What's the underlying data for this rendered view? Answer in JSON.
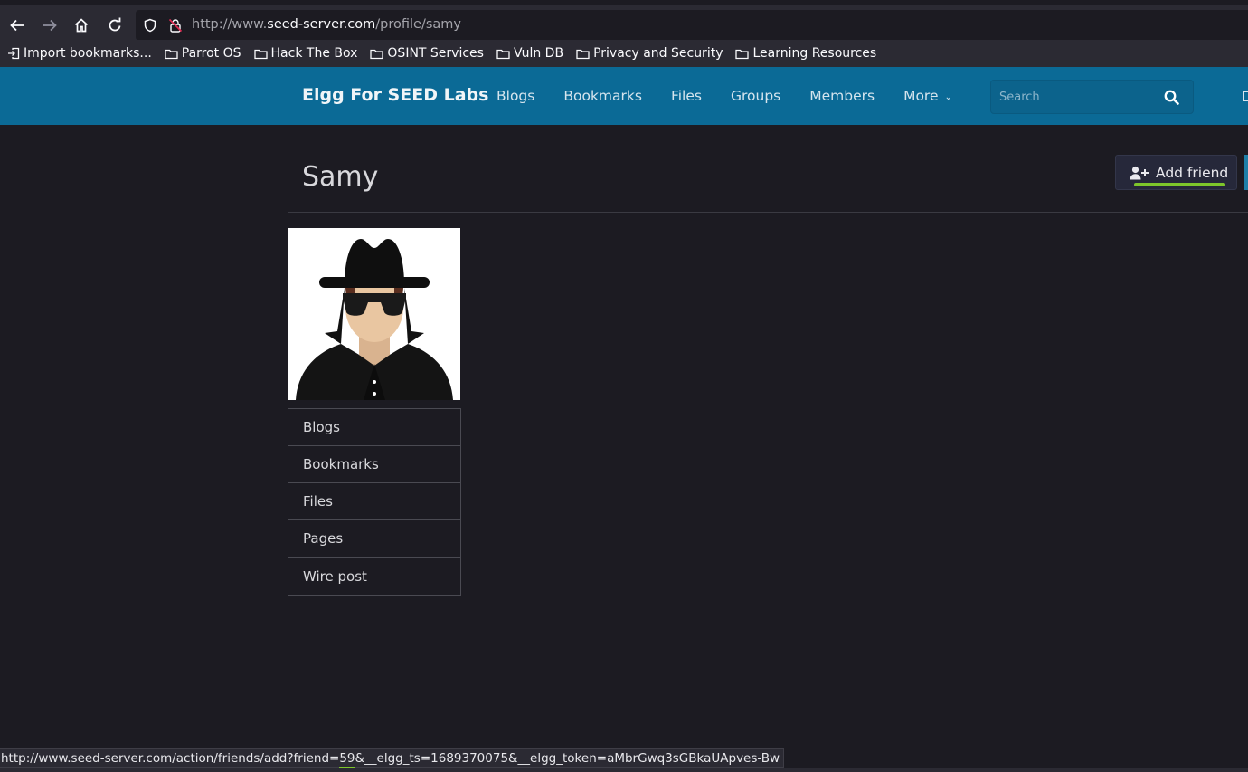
{
  "browser": {
    "url_prefix": "http://www.",
    "url_host": "seed-server.com",
    "url_path": "/profile/samy",
    "bookmarks": [
      {
        "icon": "import-icon",
        "label": "Import bookmarks..."
      },
      {
        "icon": "folder-icon",
        "label": "Parrot OS"
      },
      {
        "icon": "folder-icon",
        "label": "Hack The Box"
      },
      {
        "icon": "folder-icon",
        "label": "OSINT Services"
      },
      {
        "icon": "folder-icon",
        "label": "Vuln DB"
      },
      {
        "icon": "folder-icon",
        "label": "Privacy and Security"
      },
      {
        "icon": "folder-icon",
        "label": "Learning Resources"
      }
    ],
    "status_prefix": "http://www.seed-server.com/action/friends/add?friend=",
    "status_highlight": "59",
    "status_suffix": "&__elgg_ts=1689370075&__elgg_token=aMbrGwq3sGBkaUApves-Bw"
  },
  "site": {
    "title": "Elgg For SEED Labs",
    "menu": [
      "Blogs",
      "Bookmarks",
      "Files",
      "Groups",
      "Members"
    ],
    "more_label": "More",
    "search_placeholder": "Search",
    "header_color": "#0b6a96"
  },
  "profile": {
    "name": "Samy",
    "add_friend_label": "Add friend",
    "owner_menu": [
      "Blogs",
      "Bookmarks",
      "Files",
      "Pages",
      "Wire post"
    ]
  },
  "colors": {
    "highlight": "#7ec62b",
    "background": "#1c1b22"
  }
}
